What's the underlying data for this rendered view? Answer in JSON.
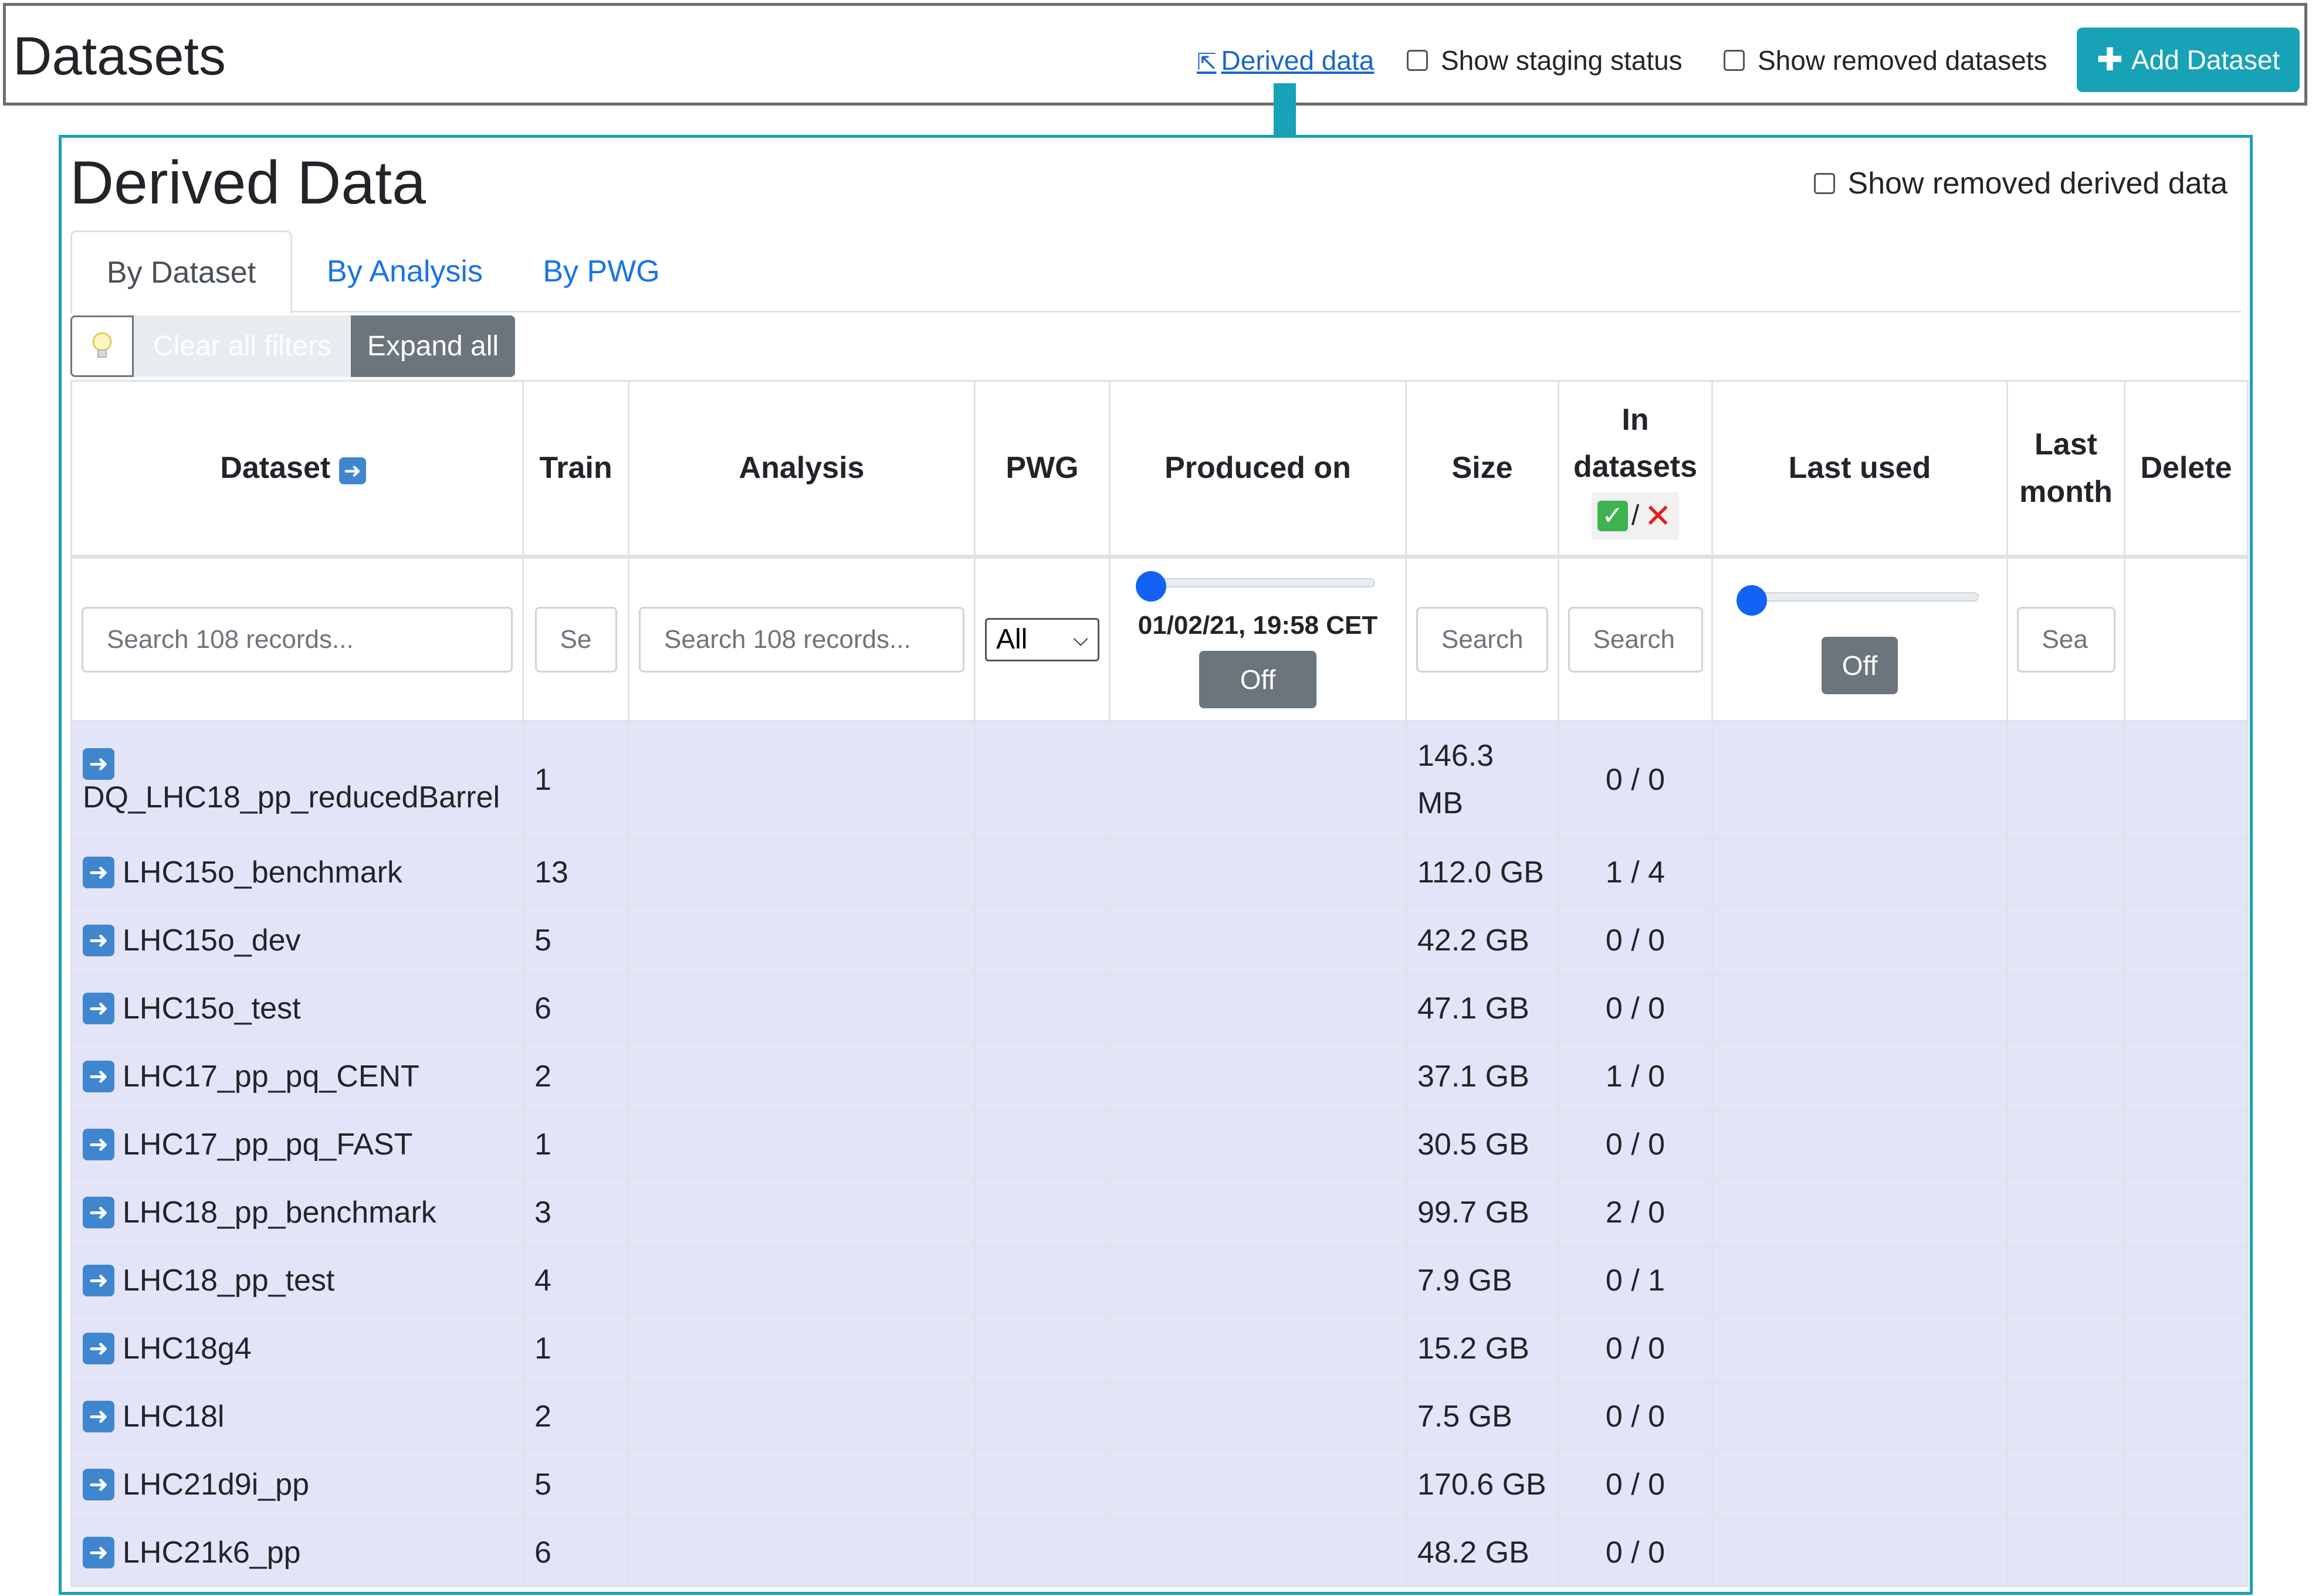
{
  "header": {
    "title": "Datasets",
    "derived_link": "Derived data",
    "show_staging_status": "Show staging status",
    "show_removed_datasets": "Show removed datasets",
    "add_dataset": "Add Dataset"
  },
  "panel": {
    "title": "Derived Data",
    "show_removed": "Show removed derived data",
    "tabs": [
      {
        "label": "By Dataset",
        "active": true
      },
      {
        "label": "By Analysis",
        "active": false
      },
      {
        "label": "By PWG",
        "active": false
      }
    ],
    "toolbar": {
      "clear_filters": "Clear all filters",
      "expand_all": "Expand all"
    }
  },
  "table": {
    "columns": {
      "dataset": "Dataset",
      "train": "Train",
      "analysis": "Analysis",
      "pwg": "PWG",
      "produced_on": "Produced on",
      "size": "Size",
      "in_datasets_1": "In",
      "in_datasets_2": "datasets",
      "last_used": "Last used",
      "last_month_1": "Last",
      "last_month_2": "month",
      "delete": "Delete"
    },
    "filters": {
      "dataset_placeholder": "Search 108 records...",
      "train_placeholder": "Se",
      "analysis_placeholder": "Search 108 records...",
      "pwg_select": "All",
      "produced_on_date": "01/02/21, 19:58 CET",
      "produced_on_toggle": "Off",
      "size_placeholder": "Search",
      "in_datasets_placeholder": "Search",
      "last_used_toggle": "Off",
      "last_month_placeholder": "Sea"
    },
    "rows": [
      {
        "dataset": "DQ_LHC18_pp_reducedBarrel",
        "train": "1",
        "size_1": "146.3",
        "size_2": "MB",
        "in_datasets": "0 / 0"
      },
      {
        "dataset": "LHC15o_benchmark",
        "train": "13",
        "size": "112.0 GB",
        "in_datasets": "1 / 4"
      },
      {
        "dataset": "LHC15o_dev",
        "train": "5",
        "size": "42.2 GB",
        "in_datasets": "0 / 0"
      },
      {
        "dataset": "LHC15o_test",
        "train": "6",
        "size": "47.1 GB",
        "in_datasets": "0 / 0"
      },
      {
        "dataset": "LHC17_pp_pq_CENT",
        "train": "2",
        "size": "37.1 GB",
        "in_datasets": "1 / 0"
      },
      {
        "dataset": "LHC17_pp_pq_FAST",
        "train": "1",
        "size": "30.5 GB",
        "in_datasets": "0 / 0"
      },
      {
        "dataset": "LHC18_pp_benchmark",
        "train": "3",
        "size": "99.7 GB",
        "in_datasets": "2 / 0"
      },
      {
        "dataset": "LHC18_pp_test",
        "train": "4",
        "size": "7.9 GB",
        "in_datasets": "0 / 1"
      },
      {
        "dataset": "LHC18g4",
        "train": "1",
        "size": "15.2 GB",
        "in_datasets": "0 / 0"
      },
      {
        "dataset": "LHC18l",
        "train": "2",
        "size": "7.5 GB",
        "in_datasets": "0 / 0"
      },
      {
        "dataset": "LHC21d9i_pp",
        "train": "5",
        "size": "170.6 GB",
        "in_datasets": "0 / 0"
      },
      {
        "dataset": "LHC21k6_pp",
        "train": "6",
        "size": "48.2 GB",
        "in_datasets": "0 / 0"
      }
    ]
  },
  "icons": {
    "dataset_row": "arrow-right-icon",
    "in_datasets_ok": "check-mark-icon",
    "in_datasets_missing": "cross-mark-icon",
    "clear_filters": "lightbulb-icon"
  },
  "colors": {
    "accent": "#17a2b8",
    "link": "#1a73e8",
    "row_bg": "#e4e4f8",
    "secondary_button": "#6c757d",
    "slider_knob": "#1262f5"
  }
}
